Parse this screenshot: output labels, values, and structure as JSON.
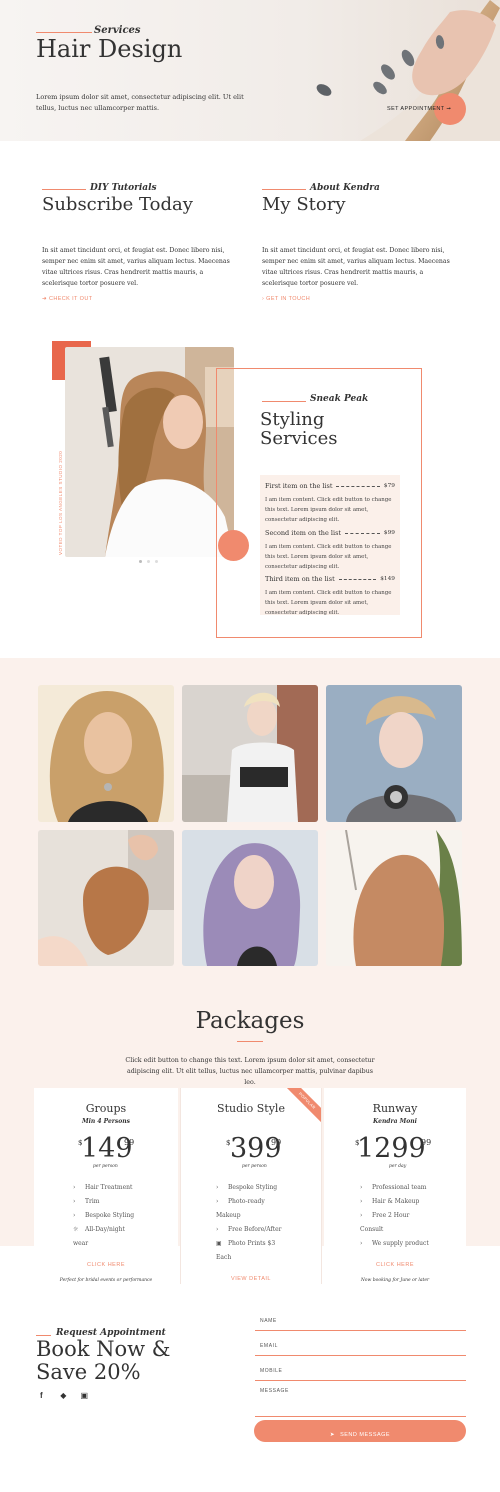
{
  "hero": {
    "tagline": "Services",
    "title": "Hair Design",
    "description": "Lorem ipsum dolor sit amet, consectetur adipiscing elit. Ut elit tellus, luctus nec ullamcorper mattis.",
    "cta_label": "SET APPOINTMENT",
    "cta_icon": "arrow-right-icon"
  },
  "subscribe": {
    "tagline": "DIY Tutorials",
    "title": "Subscribe Today",
    "body": "In sit amet tincidunt orci, et feugiat est. Donec libero nisi, semper nec enim sit amet, varius aliquam lectus. Maecenas vitae ultrices risus. Cras hendrerit mattis mauris, a scelerisque tortor posuere vel.",
    "link_label": "CHECK IT OUT"
  },
  "story": {
    "tagline": "About Kendra",
    "title": "My Story",
    "body": "In sit amet tincidunt orci, et feugiat est. Donec libero nisi, semper nec enim sit amet, varius aliquam lectus. Maecenas vitae ultrices risus. Cras hendrerit mattis mauris, a scelerisque tortor posuere vel.",
    "link_label": "GET IN TOUCH"
  },
  "styling": {
    "side_text": "VOTED TOP LOS ANGELES STUDIO 2020",
    "tagline": "Sneak Peak",
    "title_line1": "Styling",
    "title_line2": "Services",
    "items": [
      {
        "name": "First item on the list",
        "price": "$79",
        "desc": "I am item content. Click edit button to change this text. Lorem ipsum dolor sit amet, consectetur adipiscing elit."
      },
      {
        "name": "Second item on the list",
        "price": "$99",
        "desc": "I am item content. Click edit button to change this text. Lorem ipsum dolor sit amet, consectetur adipiscing elit."
      },
      {
        "name": "Third item on the list",
        "price": "$149",
        "desc": "I am item content. Click edit button to change this text. Lorem ipsum dolor sit amet, consectetur adipiscing elit."
      }
    ]
  },
  "packages": {
    "title": "Packages",
    "intro": "Click edit button to change this text. Lorem ipsum dolor sit amet, consectetur adipiscing elit. Ut elit tellus, luctus nec ullamcorper mattis, pulvinar dapibus leo.",
    "cards": [
      {
        "name": "Groups",
        "subtitle": "Min 4 Persons",
        "currency": "$",
        "price": "149",
        "cents": "99",
        "period": "per person",
        "features": [
          {
            "icon": "chevron-right-icon",
            "text": "Hair Treatment"
          },
          {
            "icon": "chevron-right-icon",
            "text": "Trim"
          },
          {
            "icon": "chevron-right-icon",
            "text": "Bespoke Styling"
          },
          {
            "icon": "sun-icon",
            "text": "All-Day/night wear"
          }
        ],
        "button": "CLICK HERE",
        "footnote": "Perfect for bridal events or performance"
      },
      {
        "name": "Studio Style",
        "subtitle": "",
        "currency": "$",
        "price": "399",
        "cents": "99",
        "period": "per person",
        "ribbon": "POPULAR",
        "features": [
          {
            "icon": "chevron-right-icon",
            "text": "Bespoke Styling"
          },
          {
            "icon": "chevron-right-icon",
            "text": "Photo-ready Makeup"
          },
          {
            "icon": "chevron-right-icon",
            "text": "Free Before/After"
          },
          {
            "icon": "instagram-icon",
            "text": "Photo Prints $3 Each"
          }
        ],
        "button": "VIEW DETAIL",
        "footnote": ""
      },
      {
        "name": "Runway",
        "subtitle": "Kendra Moni",
        "currency": "$",
        "price": "1299",
        "cents": "99",
        "period": "per day",
        "features": [
          {
            "icon": "chevron-right-icon",
            "text": "Professional team"
          },
          {
            "icon": "chevron-right-icon",
            "text": "Hair & Makeup"
          },
          {
            "icon": "chevron-right-icon",
            "text": "Free 2 Hour Consult"
          },
          {
            "icon": "chevron-right-icon",
            "text": "We supply product"
          }
        ],
        "button": "CLICK HERE",
        "footnote": "Now booking for June or later"
      }
    ]
  },
  "appointment": {
    "tagline": "Request Appointment",
    "title_line1": "Book Now &",
    "title_line2": "Save 20%",
    "social": [
      "facebook-icon",
      "twitter-icon",
      "instagram-icon"
    ],
    "fields": {
      "name": "NAME",
      "email": "EMAIL",
      "mobile": "MOBILE",
      "message": "MESSAGE"
    },
    "submit_label": "SEND MESSAGE"
  },
  "colors": {
    "accent": "#f08a6e",
    "blush": "#fbf1ec",
    "text": "#333333"
  }
}
